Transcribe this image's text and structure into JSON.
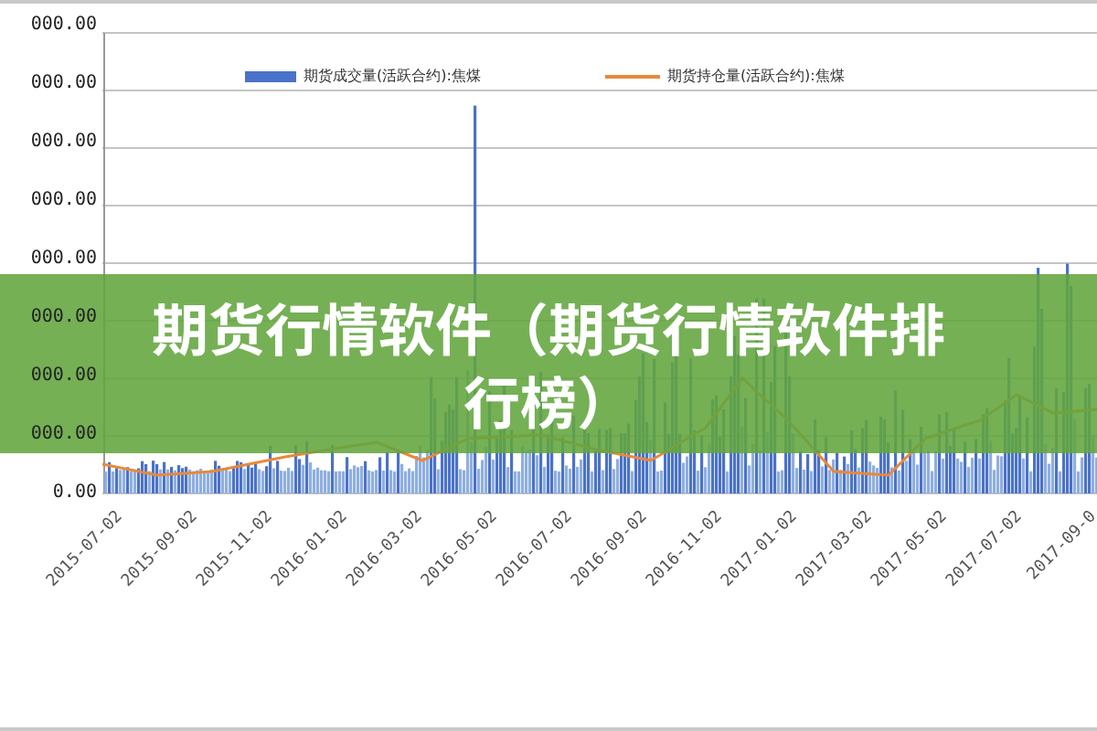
{
  "chart": {
    "y_axis_labels": [
      "000.00",
      "000.00",
      "000.00",
      "000.00",
      "000.00",
      "000.00",
      "000.00",
      "000.00",
      "0.00"
    ],
    "x_axis_labels": [
      "2015-07-02",
      "2015-09-02",
      "2015-11-02",
      "2016-01-02",
      "2016-03-02",
      "2016-05-02",
      "2016-07-02",
      "2016-09-02",
      "2016-11-02",
      "2017-01-02",
      "2017-03-02",
      "2017-05-02",
      "2017-07-02",
      "2017-09-0"
    ],
    "legend": [
      {
        "label": "期货成交量(活跃合约):焦煤",
        "kind": "bar"
      },
      {
        "label": "期货持仓量(活跃合约):焦煤",
        "kind": "line"
      }
    ]
  },
  "banner": {
    "title": "期货行情软件（期货行情软件排行榜）"
  }
}
